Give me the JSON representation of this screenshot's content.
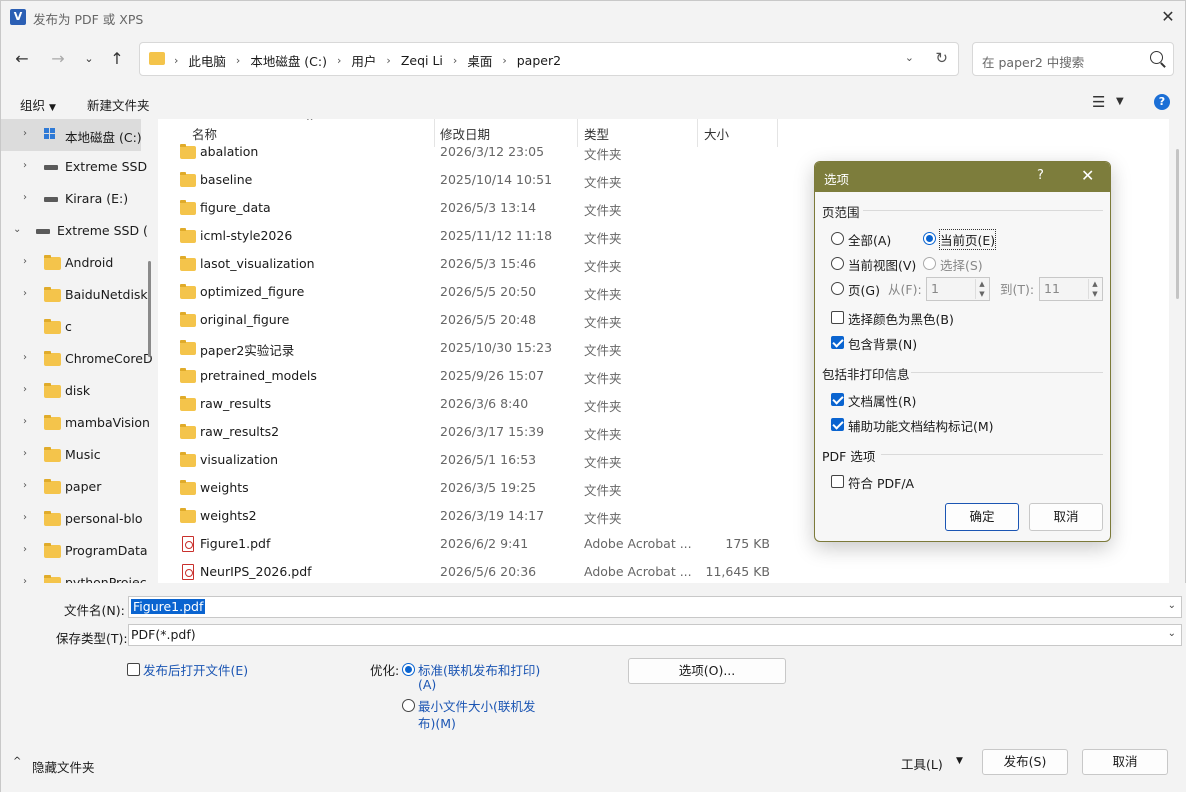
{
  "window": {
    "title": "发布为 PDF 或 XPS"
  },
  "address": {
    "crumbs": [
      "此电脑",
      "本地磁盘 (C:)",
      "用户",
      "Zeqi Li",
      "桌面",
      "paper2"
    ],
    "search_placeholder": "在 paper2 中搜索"
  },
  "toolbar": {
    "organize": "组织",
    "new_folder": "新建文件夹"
  },
  "tree": [
    {
      "label": "本地磁盘 (C:)",
      "icon": "windows-drive-icon",
      "chev": "›",
      "indent": 1,
      "selected": true
    },
    {
      "label": "Extreme SSD",
      "icon": "drive-icon",
      "chev": "›",
      "indent": 1
    },
    {
      "label": "Kirara (E:)",
      "icon": "drive-icon",
      "chev": "›",
      "indent": 1
    },
    {
      "label": "Extreme SSD (",
      "icon": "drive-icon",
      "chev": "⌄",
      "indent": 0
    },
    {
      "label": "Android",
      "icon": "folder-icon",
      "chev": "›",
      "indent": 1
    },
    {
      "label": "BaiduNetdisk",
      "icon": "folder-icon",
      "chev": "›",
      "indent": 1
    },
    {
      "label": "c",
      "icon": "folder-icon",
      "chev": "",
      "indent": 1
    },
    {
      "label": "ChromeCoreD",
      "icon": "folder-icon",
      "chev": "›",
      "indent": 1
    },
    {
      "label": "disk",
      "icon": "folder-icon",
      "chev": "›",
      "indent": 1
    },
    {
      "label": "mambaVision",
      "icon": "folder-icon",
      "chev": "›",
      "indent": 1
    },
    {
      "label": "Music",
      "icon": "folder-icon",
      "chev": "›",
      "indent": 1
    },
    {
      "label": "paper",
      "icon": "folder-icon",
      "chev": "›",
      "indent": 1
    },
    {
      "label": "personal-blo",
      "icon": "folder-icon",
      "chev": "›",
      "indent": 1
    },
    {
      "label": "ProgramData",
      "icon": "folder-icon",
      "chev": "›",
      "indent": 1
    },
    {
      "label": "pythonProjec",
      "icon": "folder-icon",
      "chev": "›",
      "indent": 1
    }
  ],
  "columns": {
    "name": "名称",
    "date": "修改日期",
    "type": "类型",
    "size": "大小"
  },
  "files": [
    {
      "name": "abalation",
      "date": "2026/3/12 23:05",
      "type": "文件夹",
      "size": "",
      "kind": "folder"
    },
    {
      "name": "baseline",
      "date": "2025/10/14 10:51",
      "type": "文件夹",
      "size": "",
      "kind": "folder"
    },
    {
      "name": "figure_data",
      "date": "2026/5/3 13:14",
      "type": "文件夹",
      "size": "",
      "kind": "folder"
    },
    {
      "name": "icml-style2026",
      "date": "2025/11/12 11:18",
      "type": "文件夹",
      "size": "",
      "kind": "folder"
    },
    {
      "name": "lasot_visualization",
      "date": "2026/5/3 15:46",
      "type": "文件夹",
      "size": "",
      "kind": "folder"
    },
    {
      "name": "optimized_figure",
      "date": "2026/5/5 20:50",
      "type": "文件夹",
      "size": "",
      "kind": "folder"
    },
    {
      "name": "original_figure",
      "date": "2026/5/5 20:48",
      "type": "文件夹",
      "size": "",
      "kind": "folder"
    },
    {
      "name": "paper2实验记录",
      "date": "2025/10/30 15:23",
      "type": "文件夹",
      "size": "",
      "kind": "folder"
    },
    {
      "name": "pretrained_models",
      "date": "2025/9/26 15:07",
      "type": "文件夹",
      "size": "",
      "kind": "folder"
    },
    {
      "name": "raw_results",
      "date": "2026/3/6 8:40",
      "type": "文件夹",
      "size": "",
      "kind": "folder"
    },
    {
      "name": "raw_results2",
      "date": "2026/3/17 15:39",
      "type": "文件夹",
      "size": "",
      "kind": "folder"
    },
    {
      "name": "visualization",
      "date": "2026/5/1 16:53",
      "type": "文件夹",
      "size": "",
      "kind": "folder"
    },
    {
      "name": "weights",
      "date": "2026/3/5 19:25",
      "type": "文件夹",
      "size": "",
      "kind": "folder"
    },
    {
      "name": "weights2",
      "date": "2026/3/19 14:17",
      "type": "文件夹",
      "size": "",
      "kind": "folder"
    },
    {
      "name": "Figure1.pdf",
      "date": "2026/6/2 9:41",
      "type": "Adobe Acrobat ...",
      "size": "175 KB",
      "kind": "pdf"
    },
    {
      "name": "NeurIPS_2026.pdf",
      "date": "2026/5/6 20:36",
      "type": "Adobe Acrobat ...",
      "size": "11,645 KB",
      "kind": "pdf"
    }
  ],
  "form": {
    "filename_label": "文件名(N):",
    "filename_value": "Figure1.pdf",
    "savetype_label": "保存类型(T):",
    "savetype_value": "PDF(*.pdf)",
    "open_after": "发布后打开文件(E)",
    "optimize_label": "优化:",
    "opt_standard_1": "标准(联机发布和打印)",
    "opt_standard_2": "(A)",
    "opt_min_1": "最小文件大小(联机发",
    "opt_min_2": "布)(M)",
    "options_button": "选项(O)...",
    "hide_folders": "隐藏文件夹",
    "tools": "工具(L)",
    "publish": "发布(S)",
    "cancel": "取消"
  },
  "dialog": {
    "title": "选项",
    "help": "?",
    "page_range": "页范围",
    "all": "全部(A)",
    "current_page": "当前页(E)",
    "current_view": "当前视图(V)",
    "selection": "选择(S)",
    "pages": "页(G)",
    "from": "从(F):",
    "from_value": "1",
    "to": "到(T):",
    "to_value": "11",
    "bw": "选择颜色为黑色(B)",
    "include_bg": "包含背景(N)",
    "nonprint": "包括非打印信息",
    "doc_props": "文档属性(R)",
    "accessibility": "辅助功能文档结构标记(M)",
    "pdf_options": "PDF 选项",
    "pdfa": "符合 PDF/A",
    "ok": "确定",
    "cancel": "取消"
  }
}
